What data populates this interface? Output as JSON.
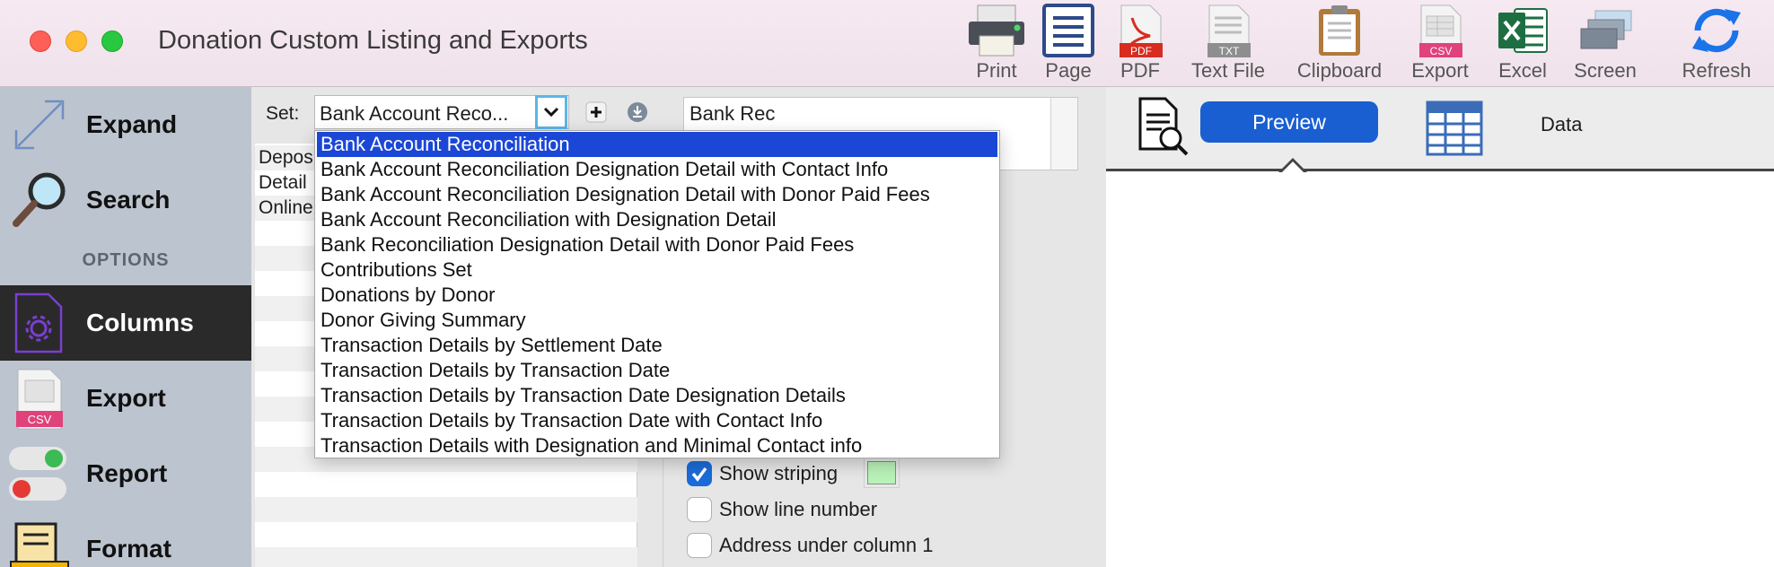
{
  "window": {
    "title": "Donation Custom Listing and Exports"
  },
  "toolbar": [
    {
      "label": "Print",
      "icon": "printer-icon"
    },
    {
      "label": "Page",
      "icon": "page-icon"
    },
    {
      "label": "PDF",
      "icon": "pdf-file-icon",
      "badge": "PDF"
    },
    {
      "label": "Text File",
      "icon": "text-file-icon",
      "badge": "TXT"
    },
    {
      "label": "Clipboard",
      "icon": "clipboard-icon"
    },
    {
      "label": "Export",
      "icon": "csv-export-icon",
      "badge": "CSV"
    },
    {
      "label": "Excel",
      "icon": "excel-icon"
    },
    {
      "label": "Screen",
      "icon": "screen-icon"
    },
    {
      "label": "Refresh",
      "icon": "refresh-icon"
    }
  ],
  "sidebar": {
    "items": [
      {
        "label": "Expand",
        "icon": "expand-arrows-icon"
      },
      {
        "label": "Search",
        "icon": "magnifier-icon"
      },
      {
        "label": "Columns",
        "icon": "columns-settings-icon",
        "active": true
      },
      {
        "label": "Export",
        "icon": "csv-export-icon",
        "badge": "CSV"
      },
      {
        "label": "Report",
        "icon": "toggle-switches-icon"
      },
      {
        "label": "Format",
        "icon": "format-ruler-icon"
      }
    ],
    "options_heading": "OPTIONS"
  },
  "set": {
    "label": "Set:",
    "selected": "Bank Account Reco...",
    "name_value": "Bank Rec"
  },
  "left_list": [
    "Deposi",
    "Detail",
    "Online"
  ],
  "options": [
    {
      "label": "Show striping",
      "checked": true
    },
    {
      "label": "Show line number",
      "checked": false
    },
    {
      "label": "Address under column 1",
      "checked": false
    }
  ],
  "stripe_color": "#b9f2b8",
  "preview": {
    "preview_label": "Preview",
    "data_label": "Data"
  },
  "dropdown": {
    "selected_index": 0,
    "items": [
      "Bank Account Reconciliation",
      "Bank Account Reconciliation Designation Detail with Contact Info",
      "Bank Account Reconciliation Designation Detail with Donor Paid Fees",
      "Bank Account Reconciliation with Designation Detail",
      "Bank Reconciliation Designation Detail with Donor Paid Fees",
      "Contributions Set",
      "Donations by Donor",
      "Donor Giving Summary",
      "Transaction Details by Settlement Date",
      "Transaction Details by Transaction Date",
      "Transaction Details by Transaction Date Designation Details",
      "Transaction Details by Transaction Date with Contact Info",
      "Transaction Details with Designation and Minimal Contact info"
    ]
  },
  "colors": {
    "accent": "#1a5fd1",
    "selection": "#1b47d6",
    "sidebar_bg": "#bcc4cf",
    "sidebar_active": "#2a2a2a"
  }
}
